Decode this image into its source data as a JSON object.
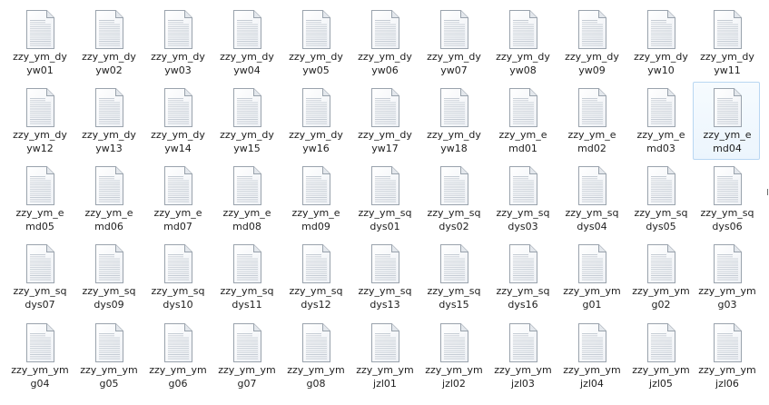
{
  "icons": {
    "file": "document-icon"
  },
  "selected_index": 14,
  "files": [
    [
      "zzy_ym_dy",
      "yw01"
    ],
    [
      "zzy_ym_dy",
      "yw02"
    ],
    [
      "zzy_ym_dy",
      "yw03"
    ],
    [
      "zzy_ym_dy",
      "yw04"
    ],
    [
      "zzy_ym_dy",
      "yw05"
    ],
    [
      "zzy_ym_dy",
      "yw06"
    ],
    [
      "zzy_ym_dy",
      "yw07"
    ],
    [
      "zzy_ym_dy",
      "yw08"
    ],
    [
      "zzy_ym_dy",
      "yw09"
    ],
    [
      "zzy_ym_dy",
      "yw10"
    ],
    [
      "zzy_ym_dy",
      "yw11"
    ],
    [
      "zzy_ym_dy",
      "yw12"
    ],
    [
      "zzy_ym_dy",
      "yw13"
    ],
    [
      "zzy_ym_dy",
      "yw14"
    ],
    [
      "zzy_ym_dy",
      "yw15"
    ],
    [
      "zzy_ym_dy",
      "yw16"
    ],
    [
      "zzy_ym_dy",
      "yw17"
    ],
    [
      "zzy_ym_dy",
      "yw18"
    ],
    [
      "zzy_ym_e",
      "md01"
    ],
    [
      "zzy_ym_e",
      "md02"
    ],
    [
      "zzy_ym_e",
      "md03"
    ],
    [
      "zzy_ym_e",
      "md04"
    ],
    [
      "zzy_ym_e",
      "md05"
    ],
    [
      "zzy_ym_e",
      "md06"
    ],
    [
      "zzy_ym_e",
      "md07"
    ],
    [
      "zzy_ym_e",
      "md08"
    ],
    [
      "zzy_ym_e",
      "md09"
    ],
    [
      "zzy_ym_sq",
      "dys01"
    ],
    [
      "zzy_ym_sq",
      "dys02"
    ],
    [
      "zzy_ym_sq",
      "dys03"
    ],
    [
      "zzy_ym_sq",
      "dys04"
    ],
    [
      "zzy_ym_sq",
      "dys05"
    ],
    [
      "zzy_ym_sq",
      "dys06"
    ],
    [
      "zzy_ym_sq",
      "dys07"
    ],
    [
      "zzy_ym_sq",
      "dys09"
    ],
    [
      "zzy_ym_sq",
      "dys10"
    ],
    [
      "zzy_ym_sq",
      "dys11"
    ],
    [
      "zzy_ym_sq",
      "dys12"
    ],
    [
      "zzy_ym_sq",
      "dys13"
    ],
    [
      "zzy_ym_sq",
      "dys15"
    ],
    [
      "zzy_ym_sq",
      "dys16"
    ],
    [
      "zzy_ym_ym",
      "g01"
    ],
    [
      "zzy_ym_ym",
      "g02"
    ],
    [
      "zzy_ym_ym",
      "g03"
    ],
    [
      "zzy_ym_ym",
      "g04"
    ],
    [
      "zzy_ym_ym",
      "g05"
    ],
    [
      "zzy_ym_ym",
      "g06"
    ],
    [
      "zzy_ym_ym",
      "g07"
    ],
    [
      "zzy_ym_ym",
      "g08"
    ],
    [
      "zzy_ym_ym",
      "jzl01"
    ],
    [
      "zzy_ym_ym",
      "jzl02"
    ],
    [
      "zzy_ym_ym",
      "jzl03"
    ],
    [
      "zzy_ym_ym",
      "jzl04"
    ],
    [
      "zzy_ym_ym",
      "jzl05"
    ],
    [
      "zzy_ym_ym",
      "jzl06"
    ]
  ]
}
